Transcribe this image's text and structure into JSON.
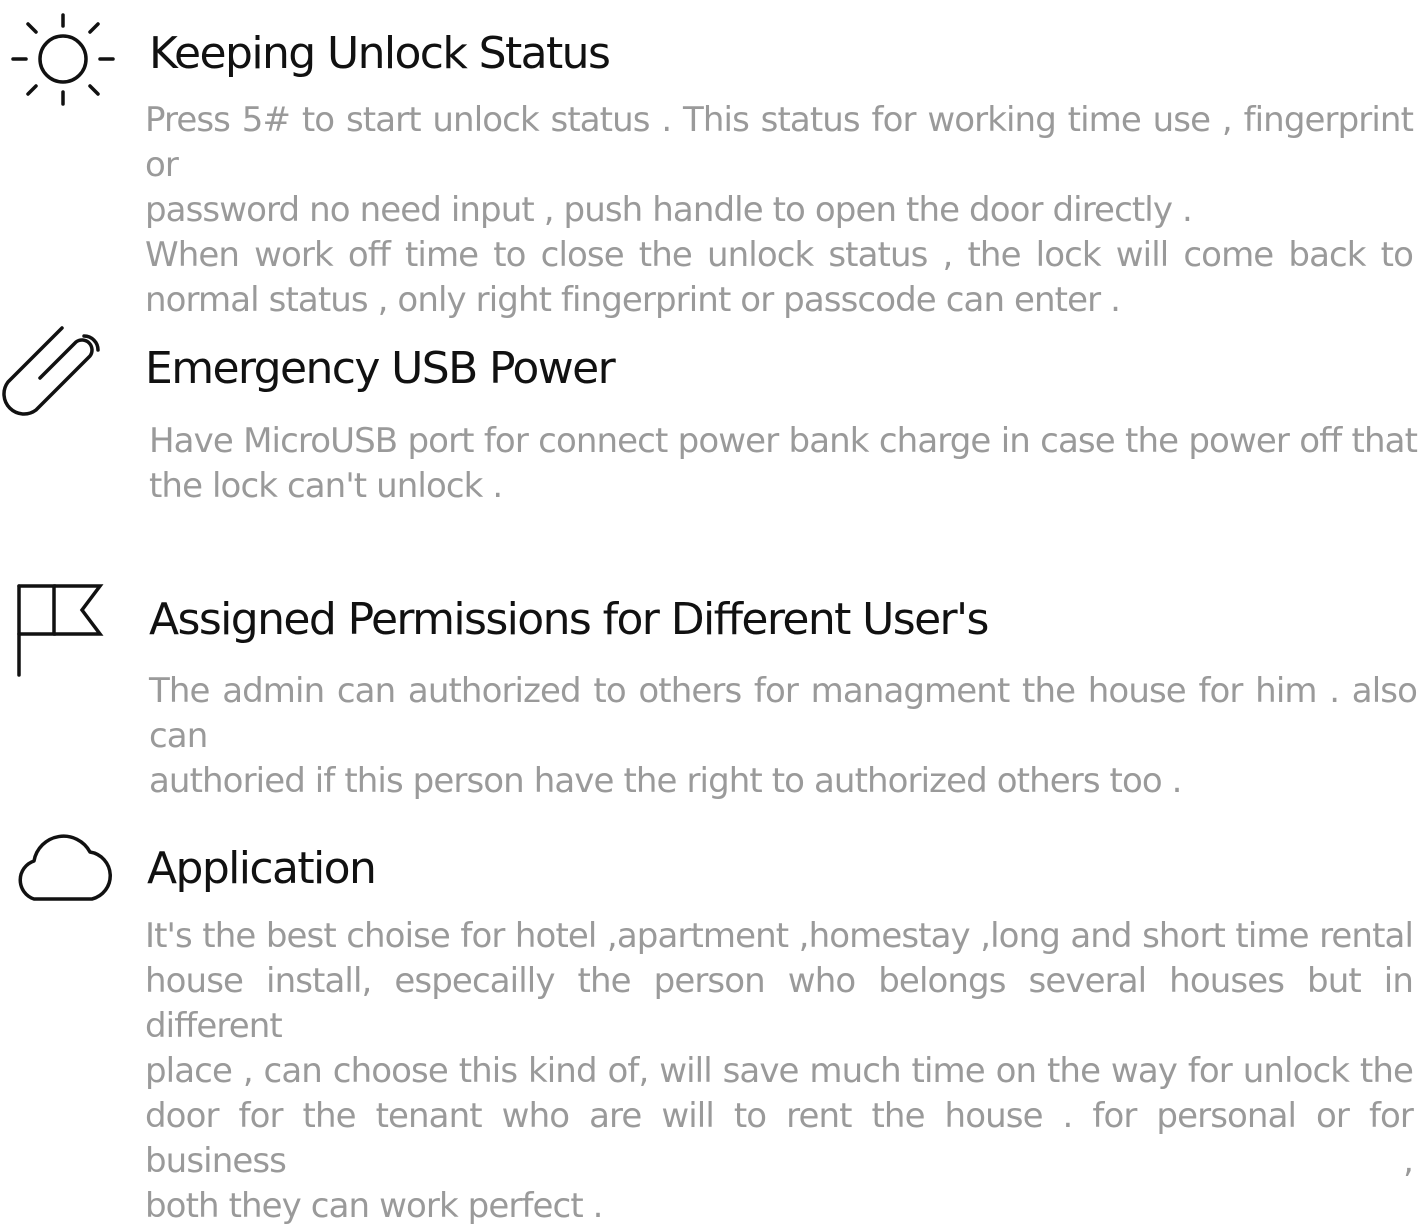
{
  "features": [
    {
      "icon": "sun-icon",
      "title": "Keeping Unlock Status",
      "lines": [
        "Press 5# to start unlock status . This status for working time use , fingerprint or",
        "password no need input , push handle to open the door directly .",
        "When work off time to close the unlock status , the lock will  come back to",
        "normal status , only right fingerprint or passcode can enter ."
      ]
    },
    {
      "icon": "paperclip-icon",
      "title": "Emergency USB Power",
      "lines": [
        "Have MicroUSB port for connect power bank charge in case the power off that",
        "the lock can't unlock ."
      ]
    },
    {
      "icon": "flag-icon",
      "title": "Assigned Permissions for Different User's",
      "lines": [
        "The admin can authorized to others for managment the house for him . also can",
        "authoried if this person have the right to authorized others too ."
      ]
    },
    {
      "icon": "cloud-icon",
      "title": "Application",
      "lines": [
        "It's the best choise for hotel ,apartment ,homestay ,long and short time rental",
        "house install, especailly the person who belongs several houses but in different",
        "place , can choose this kind of, will save much time on the way for unlock the",
        "door for the  tenant who are will to rent the house .  for personal or for business ,",
        "both they can work perfect ."
      ]
    }
  ]
}
